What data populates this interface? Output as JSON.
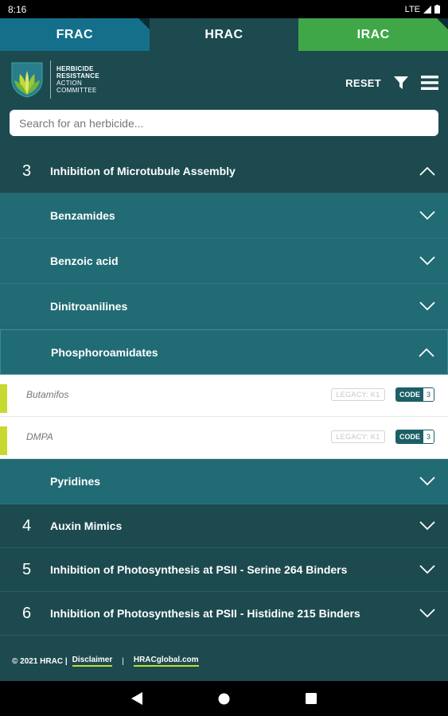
{
  "status": {
    "time": "8:16",
    "network": "LTE"
  },
  "tabs": [
    {
      "label": "FRAC"
    },
    {
      "label": "HRAC"
    },
    {
      "label": "IRAC"
    }
  ],
  "header": {
    "logo_lines": [
      "HERBICIDE",
      "RESISTANCE",
      "ACTION",
      "COMMITTEE"
    ],
    "reset_label": "RESET"
  },
  "search": {
    "placeholder": "Search for an herbicide..."
  },
  "list": {
    "group3": {
      "num": "3",
      "label": "Inhibition of Microtubule Assembly"
    },
    "subs": [
      {
        "label": "Benzamides"
      },
      {
        "label": "Benzoic acid"
      },
      {
        "label": "Dinitroanilines"
      },
      {
        "label": "Phosphoroamidates"
      }
    ],
    "items": [
      {
        "name": "Butamifos",
        "legacy": "LEGACY: K1",
        "code_label": "CODE",
        "code_value": "3"
      },
      {
        "name": "DMPA",
        "legacy": "LEGACY: K1",
        "code_label": "CODE",
        "code_value": "3"
      }
    ],
    "sub_after": {
      "label": "Pyridines"
    },
    "groups": [
      {
        "num": "4",
        "label": "Auxin Mimics"
      },
      {
        "num": "5",
        "label": "Inhibition of Photosynthesis at PSII - Serine 264 Binders"
      },
      {
        "num": "6",
        "label": "Inhibition of Photosynthesis at PSII - Histidine 215 Binders"
      }
    ]
  },
  "footer": {
    "copyright": "© 2021 HRAC |",
    "disclaimer": "Disclaimer",
    "separator": "|",
    "site": "HRACglobal.com"
  },
  "colors": {
    "frac": "#14708a",
    "hrac": "#1c4a4f",
    "irac": "#3fa748",
    "accent": "#c7d92f",
    "sub_bg": "#216b75"
  }
}
